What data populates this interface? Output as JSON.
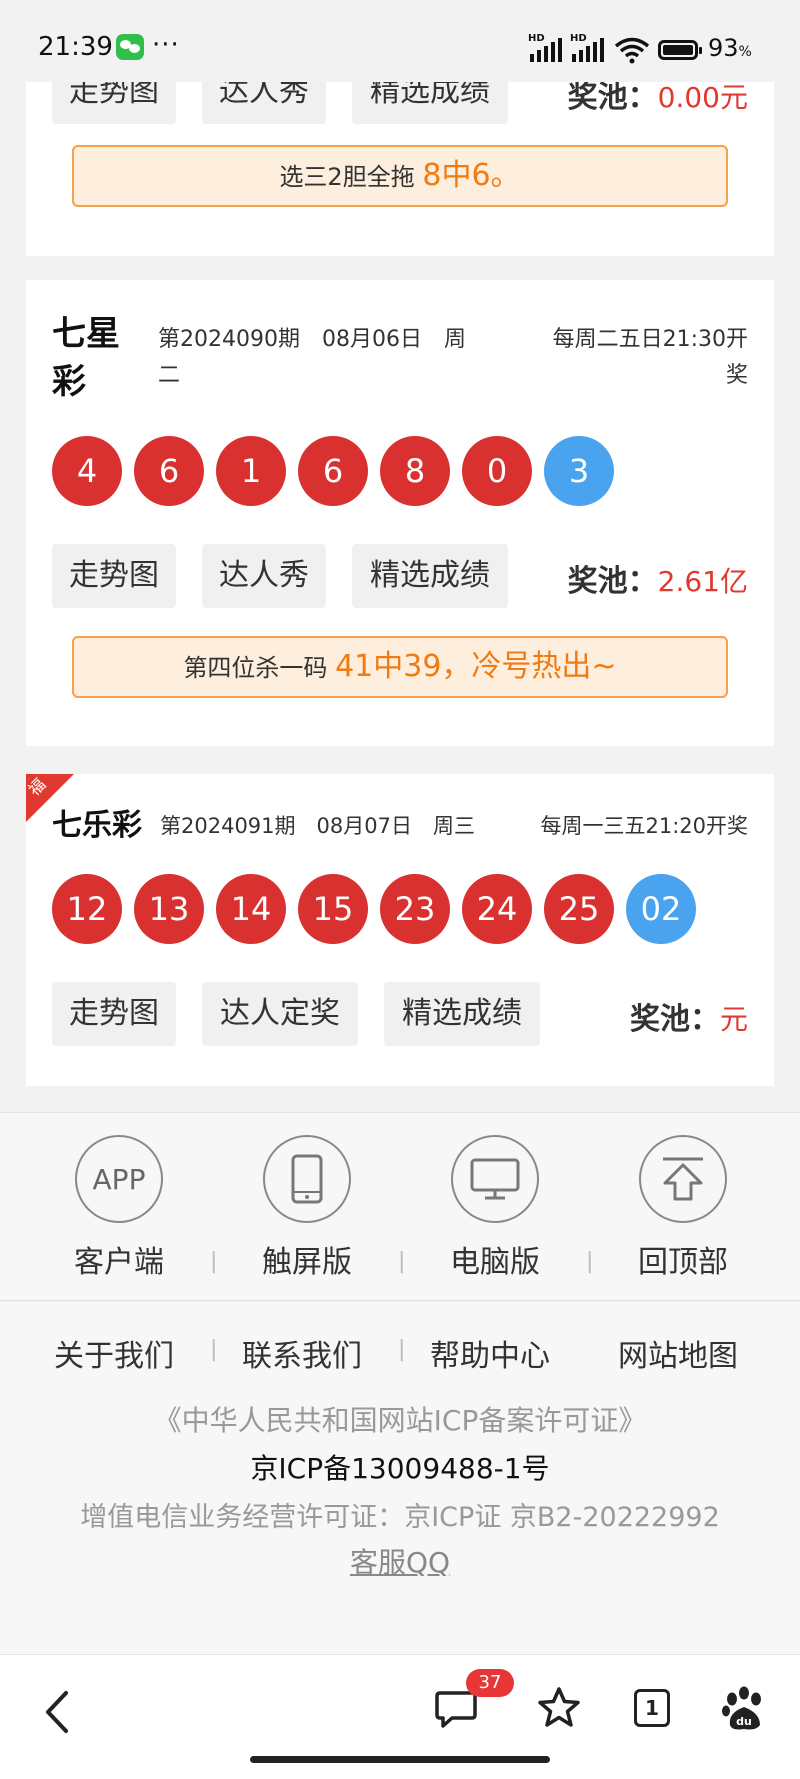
{
  "status_bar": {
    "time": "21:39",
    "more": "···",
    "hd": "HD",
    "battery": "93",
    "battery_unit": "%"
  },
  "lotteries": [
    {
      "buttons": [
        "走势图",
        "达人秀",
        "精选成绩"
      ],
      "pool_label": "奖池：",
      "pool_amount": "0.00元",
      "tip_text": "选三2胆全拖",
      "tip_highlight": "8中6。"
    },
    {
      "name": "七星彩",
      "issue": "第2024090期",
      "date": "08月06日",
      "weekday": "周二",
      "schedule": "每周二五日21:30开奖",
      "numbers": [
        "4",
        "6",
        "1",
        "6",
        "8",
        "0"
      ],
      "special": [
        "3"
      ],
      "buttons": [
        "走势图",
        "达人秀",
        "精选成绩"
      ],
      "pool_label": "奖池：",
      "pool_amount": "2.61亿",
      "tip_text": "第四位杀一码",
      "tip_highlight": "41中39，冷号热出~"
    },
    {
      "name": "七乐彩",
      "corner_badge": "福",
      "issue": "第2024091期",
      "date": "08月07日",
      "weekday": "周三",
      "schedule": "每周一三五21:20开奖",
      "numbers": [
        "12",
        "13",
        "14",
        "15",
        "23",
        "24",
        "25"
      ],
      "special": [
        "02"
      ],
      "buttons": [
        "走势图",
        "达人定奖",
        "精选成绩"
      ],
      "pool_label": "奖池：",
      "pool_amount": "元"
    }
  ],
  "app_nav": [
    {
      "icon": "APP",
      "label": "客户端"
    },
    {
      "label": "触屏版"
    },
    {
      "label": "电脑版"
    },
    {
      "label": "回顶部"
    }
  ],
  "footer": {
    "links": [
      "关于我们",
      "联系我们",
      "帮助中心",
      "网站地图"
    ],
    "icp_title": "《中华人民共和国网站ICP备案许可证》",
    "icp_number": "京ICP备13009488-1号",
    "license": "增值电信业务经营许可证：京ICP证 京B2-20222992",
    "service_qq": "客服QQ"
  },
  "browser": {
    "comment_count": "37",
    "tab_count": "1"
  },
  "colors": {
    "red_ball": "#d93030",
    "blue_ball": "#4aa3ef",
    "highlight": "#f07b12",
    "pool_amount": "#e0392f"
  }
}
